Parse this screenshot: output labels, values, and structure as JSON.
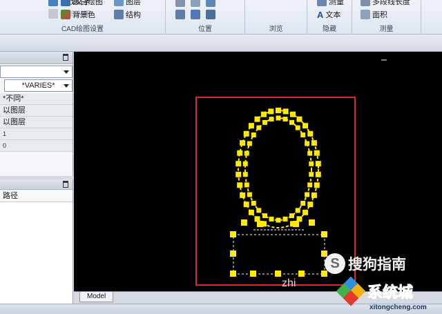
{
  "ribbon": {
    "groups": [
      {
        "label": "CAD绘图设置",
        "buttons": {
          "find_text": "查找文字",
          "trim_cursor": "修剪光栅",
          "black_white": "黑白绘图",
          "layer": "图层",
          "background": "背景色",
          "structure": "结构"
        }
      },
      {
        "label": "位置"
      },
      {
        "label": "浏览"
      },
      {
        "label": "隐藏",
        "buttons": {
          "measure": "测量",
          "text": "文本"
        }
      },
      {
        "label": "测量",
        "buttons": {
          "polyline_length": "多段线长度",
          "area": "面积"
        }
      }
    ]
  },
  "properties_panel": {
    "layer_value": "*VARIES*",
    "rows": [
      "*不同*",
      "以图层",
      "以图层",
      "1",
      "0"
    ]
  },
  "paths_panel": {
    "header": "路径"
  },
  "drawing": {
    "tab": "Model",
    "selection_color": "#ffea00",
    "frame_color": "#e0282e"
  },
  "watermarks": {
    "sogou": "搜狗指南",
    "zhi": "zhi",
    "xitong": "系统城",
    "url": "xitongcheng.com"
  }
}
